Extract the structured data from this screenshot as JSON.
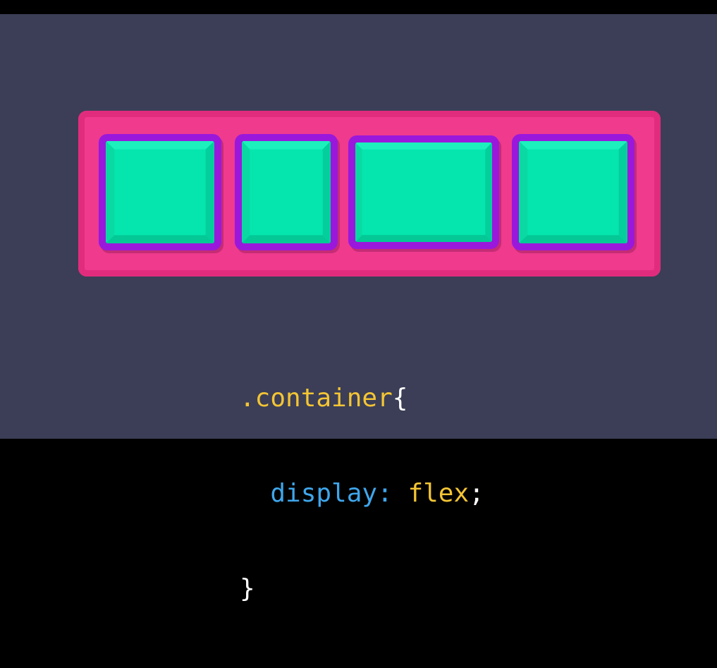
{
  "code": {
    "selector": ".container",
    "open_brace": "{",
    "indent": "  ",
    "property": "display",
    "colon": ": ",
    "value": "flex",
    "semicolon": ";",
    "close_brace": "}"
  },
  "colors": {
    "background": "#3b3e56",
    "container": "#ef3a8e",
    "item_border": "#9a18dc",
    "item_face": "#05e6ae",
    "selector_text": "#f4c534",
    "property_text": "#3fa6ec"
  }
}
